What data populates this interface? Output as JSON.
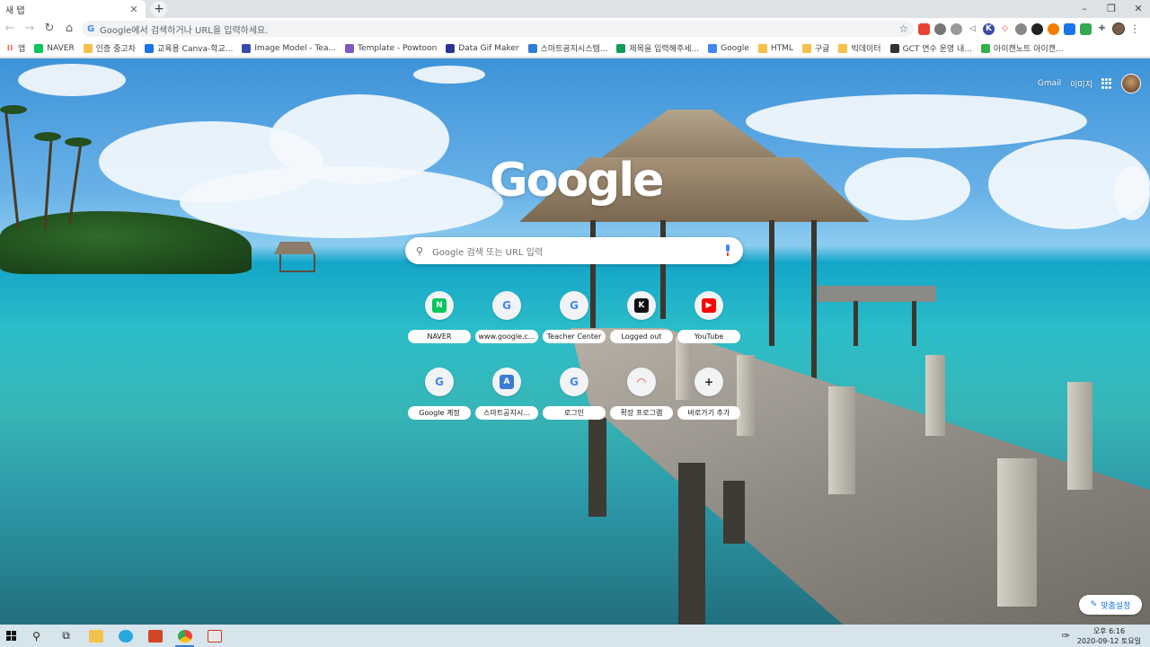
{
  "browser": {
    "tab_title": "새 탭",
    "tab_close": "✕",
    "new_tab": "+",
    "window_controls": [
      "–",
      "❐",
      "✕"
    ],
    "omnibox_placeholder": "Google에서 검색하거나 URL을 입력하세요.",
    "omnibox_icon": "G"
  },
  "bookmarks": [
    {
      "label": "앱",
      "icon": "apps-icon",
      "color": "#ea4335"
    },
    {
      "label": "NAVER",
      "icon": "naver-icon",
      "color": "#03c75a"
    },
    {
      "label": "인증 중고차",
      "icon": "folder-icon",
      "color": "#f4c24b"
    },
    {
      "label": "교육용 Canva-학교...",
      "icon": "canva-icon",
      "color": "#1a73e8"
    },
    {
      "label": "Image Model - Tea...",
      "icon": "teachable-icon",
      "color": "#3949ab"
    },
    {
      "label": "Template - Powtoon",
      "icon": "powtoon-icon",
      "color": "#7e57c2"
    },
    {
      "label": "Data Gif Maker",
      "icon": "datagif-icon",
      "color": "#283593"
    },
    {
      "label": "스마트공지시스템...",
      "icon": "smartnotice-icon",
      "color": "#2e7dd7"
    },
    {
      "label": "제목을 입력해주세...",
      "icon": "green-circle-icon",
      "color": "#0f9d58"
    },
    {
      "label": "Google",
      "icon": "google-icon",
      "color": "#4285f4"
    },
    {
      "label": "HTML",
      "icon": "folder-icon",
      "color": "#f4c24b"
    },
    {
      "label": "구글",
      "icon": "folder-icon",
      "color": "#f4c24b"
    },
    {
      "label": "빅데이터",
      "icon": "folder-icon",
      "color": "#f4c24b"
    },
    {
      "label": "GCT 연수 운영 내...",
      "icon": "gct-icon",
      "color": "#333333"
    },
    {
      "label": "아이캔노트 아이캔...",
      "icon": "icannote-icon",
      "color": "#2fb344"
    }
  ],
  "ntp": {
    "gmail": "Gmail",
    "images": "이미지",
    "logo": "Google",
    "search_placeholder": "Google 검색 또는 URL 입력",
    "shortcuts": [
      {
        "label": "NAVER",
        "glyph": "N",
        "color": "#03c75a"
      },
      {
        "label": "www.google.c...",
        "glyph": "G",
        "color": "#4285f4"
      },
      {
        "label": "Teacher Center",
        "glyph": "G",
        "color": "#4285f4"
      },
      {
        "label": "Logged out",
        "glyph": "K",
        "color": "#111111"
      },
      {
        "label": "YouTube",
        "glyph": "▶",
        "color": "#ff0000"
      },
      {
        "label": "Google 계정",
        "glyph": "G",
        "color": "#4285f4"
      },
      {
        "label": "스마트공지시...",
        "glyph": "A",
        "color": "#3a7bd5"
      },
      {
        "label": "로그인",
        "glyph": "G",
        "color": "#4285f4"
      },
      {
        "label": "확장 프로그램",
        "glyph": "◠",
        "color": "#ea4335"
      },
      {
        "label": "바로가기 추가",
        "glyph": "+",
        "color": "#202124"
      }
    ],
    "customize": "맞춤설정"
  },
  "taskbar": {
    "time": "오후 6:16",
    "date": "2020-09-12 토요일"
  }
}
